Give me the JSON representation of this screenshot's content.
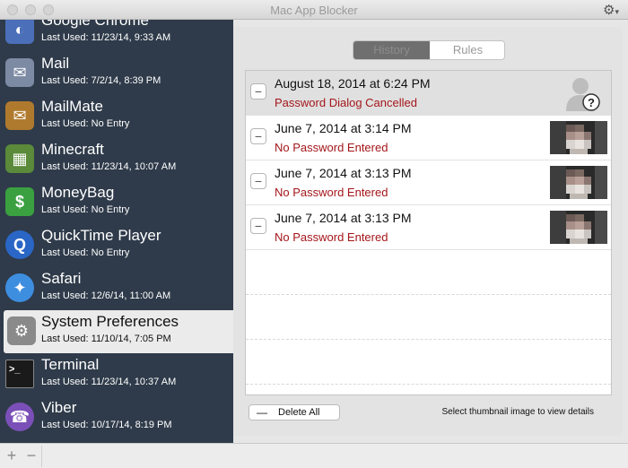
{
  "window": {
    "title": "Mac App Blocker"
  },
  "icons": {
    "gear": "gear-icon",
    "chevron": "chevron-down-icon"
  },
  "sidebar": {
    "apps": [
      {
        "name": "Google Chrome",
        "last_used": "Last Used: 11/23/14, 9:33 AM",
        "icon": "chrome-icon",
        "color": "#4b6fb8"
      },
      {
        "name": "Mail",
        "last_used": "Last Used: 7/2/14, 8:39 PM",
        "icon": "mail-icon",
        "color": "#7d8aa4"
      },
      {
        "name": "MailMate",
        "last_used": "Last Used: No Entry",
        "icon": "mailmate-icon",
        "color": "#b07a2e"
      },
      {
        "name": "Minecraft",
        "last_used": "Last Used: 11/23/14, 10:07 AM",
        "icon": "minecraft-icon",
        "color": "#5a8a3a"
      },
      {
        "name": "MoneyBag",
        "last_used": "Last Used: No Entry",
        "icon": "moneybag-icon",
        "color": "#3aa040"
      },
      {
        "name": "QuickTime Player",
        "last_used": "Last Used: No Entry",
        "icon": "quicktime-icon",
        "color": "#2a66c6"
      },
      {
        "name": "Safari",
        "last_used": "Last Used: 12/6/14, 11:00 AM",
        "icon": "safari-icon",
        "color": "#3e8ee0"
      },
      {
        "name": "System Preferences",
        "last_used": "Last Used: 11/10/14, 7:05 PM",
        "icon": "system-preferences-icon",
        "color": "#8a8a8a"
      },
      {
        "name": "Terminal",
        "last_used": "Last Used: 11/23/14, 10:37 AM",
        "icon": "terminal-icon",
        "color": "#1a1a1a"
      },
      {
        "name": "Viber",
        "last_used": "Last Used: 10/17/14, 8:19 PM",
        "icon": "viber-icon",
        "color": "#7b4fb8"
      }
    ],
    "selected_index": 7
  },
  "tabs": {
    "history": "History",
    "rules": "Rules",
    "active": "history"
  },
  "history": [
    {
      "date": "August 18, 2014 at 6:24 PM",
      "status": "Password Dialog Cancelled",
      "thumb": "unknown-user-icon"
    },
    {
      "date": "June 7, 2014 at 3:14 PM",
      "status": "No Password Entered",
      "thumb": "photo-thumbnail"
    },
    {
      "date": "June 7, 2014 at 3:13 PM",
      "status": "No Password Entered",
      "thumb": "photo-thumbnail"
    },
    {
      "date": "June 7, 2014 at 3:13 PM",
      "status": "No Password Entered",
      "thumb": "photo-thumbnail"
    }
  ],
  "footer": {
    "delete_all": "Delete All",
    "hint": "Select thumbnail image to view details"
  },
  "bottombar": {
    "add": "+",
    "remove": "−"
  },
  "colors": {
    "sidebar": "#2f3b4a",
    "status_red": "#a4161a"
  }
}
